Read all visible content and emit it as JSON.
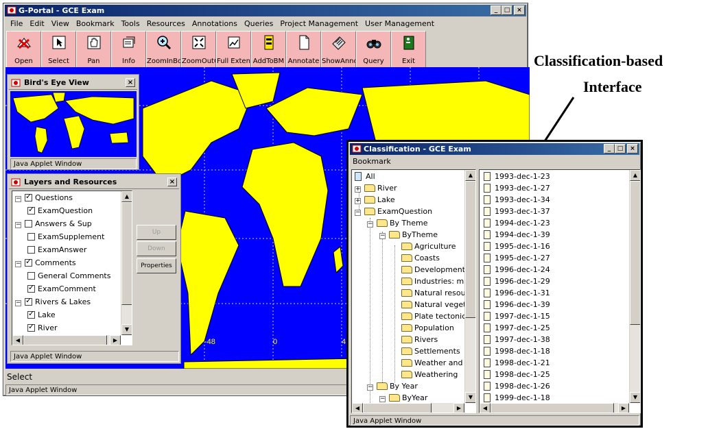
{
  "main_window": {
    "title": "G-Portal - GCE Exam",
    "menu": [
      "File",
      "Edit",
      "View",
      "Bookmark",
      "Tools",
      "Resources",
      "Annotations",
      "Queries",
      "Project Management",
      "User Management"
    ],
    "toolbar": [
      "Open",
      "Select",
      "Pan",
      "Info",
      "ZoomInBox",
      "ZoomOutCtr",
      "Full Extent",
      "AddToBM",
      "Annotate",
      "ShowAnno",
      "Query",
      "Exit"
    ],
    "status_text": "Select",
    "applet_label": "Java Applet Window",
    "map_labels": [
      "-48",
      "0",
      "4"
    ]
  },
  "birds_eye": {
    "title": "Bird's Eye View",
    "applet_label": "Java Applet Window"
  },
  "layers": {
    "title": "Layers and Resources",
    "items": [
      {
        "label": "Questions",
        "level": 0,
        "checked": true
      },
      {
        "label": "ExamQuestion",
        "level": 1,
        "checked": true
      },
      {
        "label": "Answers & Sup",
        "level": 0,
        "checked": false
      },
      {
        "label": "ExamSupplement",
        "level": 1,
        "checked": false
      },
      {
        "label": "ExamAnswer",
        "level": 1,
        "checked": false
      },
      {
        "label": "Comments",
        "level": 0,
        "checked": true
      },
      {
        "label": "General Comments",
        "level": 1,
        "checked": false
      },
      {
        "label": "ExamComment",
        "level": 1,
        "checked": true
      },
      {
        "label": "Rivers & Lakes",
        "level": 0,
        "checked": true
      },
      {
        "label": "Lake",
        "level": 1,
        "checked": true
      },
      {
        "label": "River",
        "level": 1,
        "checked": true
      }
    ],
    "buttons": {
      "up": "Up",
      "down": "Down",
      "properties": "Properties"
    },
    "applet_label": "Java Applet Window"
  },
  "classification": {
    "title": "Classification - GCE Exam",
    "menu": "Bookmark",
    "tree": [
      {
        "label": "All",
        "level": 0,
        "type": "root"
      },
      {
        "label": "River",
        "level": 1,
        "type": "folder",
        "exp": "+"
      },
      {
        "label": "Lake",
        "level": 1,
        "type": "folder",
        "exp": "+"
      },
      {
        "label": "ExamQuestion",
        "level": 1,
        "type": "folder",
        "exp": "-"
      },
      {
        "label": "By Theme",
        "level": 2,
        "type": "folder",
        "exp": "-"
      },
      {
        "label": "ByTheme",
        "level": 3,
        "type": "folder",
        "exp": "-"
      },
      {
        "label": "Agriculture",
        "level": 4,
        "type": "folder"
      },
      {
        "label": "Coasts",
        "level": 4,
        "type": "folder"
      },
      {
        "label": "Development",
        "level": 4,
        "type": "folder"
      },
      {
        "label": "Industries: m",
        "level": 4,
        "type": "folder"
      },
      {
        "label": "Natural resou",
        "level": 4,
        "type": "folder"
      },
      {
        "label": "Natural veget",
        "level": 4,
        "type": "folder"
      },
      {
        "label": "Plate tectonic",
        "level": 4,
        "type": "folder"
      },
      {
        "label": "Population",
        "level": 4,
        "type": "folder"
      },
      {
        "label": "Rivers",
        "level": 4,
        "type": "folder"
      },
      {
        "label": "Settlements",
        "level": 4,
        "type": "folder"
      },
      {
        "label": "Weather and",
        "level": 4,
        "type": "folder"
      },
      {
        "label": "Weathering",
        "level": 4,
        "type": "folder"
      },
      {
        "label": "By Year",
        "level": 2,
        "type": "folder",
        "exp": "-"
      },
      {
        "label": "ByYear",
        "level": 3,
        "type": "folder",
        "exp": "-"
      }
    ],
    "documents": [
      "1993-dec-1-23",
      "1993-dec-1-27",
      "1993-dec-1-34",
      "1993-dec-1-37",
      "1994-dec-1-23",
      "1994-dec-1-39",
      "1995-dec-1-16",
      "1995-dec-1-27",
      "1996-dec-1-24",
      "1996-dec-1-29",
      "1996-dec-1-31",
      "1996-dec-1-39",
      "1997-dec-1-15",
      "1997-dec-1-25",
      "1997-dec-1-38",
      "1998-dec-1-18",
      "1998-dec-1-21",
      "1998-dec-1-25",
      "1998-dec-1-26",
      "1999-dec-1-18"
    ],
    "applet_label": "Java Applet Window"
  },
  "annotation": {
    "line1": "Classification-based",
    "line2": "Interface"
  },
  "colors": {
    "map_ocean": "#0000ff",
    "land": "#ffff00",
    "toolbar_button": "#f4b6b6",
    "title_active": "#0a246a"
  }
}
